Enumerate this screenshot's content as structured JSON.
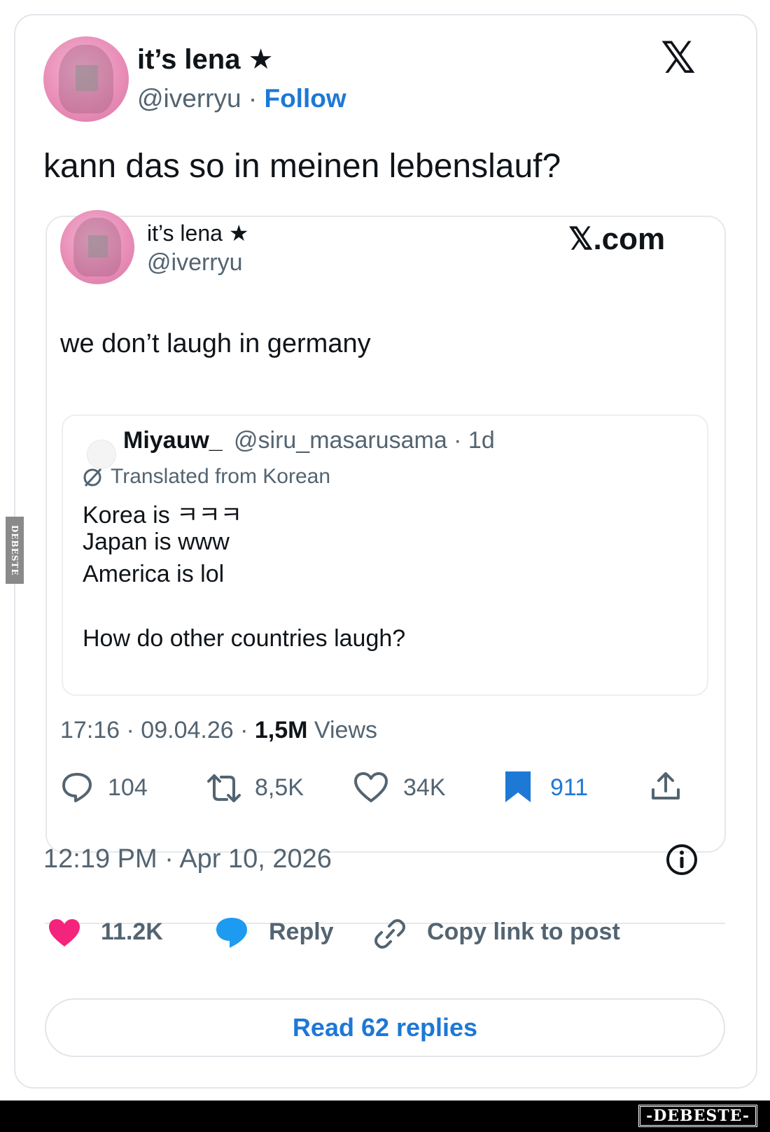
{
  "outer_tweet": {
    "author_name": "it’s lena ★",
    "handle": "@iverryu",
    "separator": "·",
    "follow_label": "Follow",
    "platform_logo": "𝕏",
    "text": "kann das so in meinen lebenslauf?",
    "timestamp": "12:19 PM · Apr 10, 2026",
    "info_icon": "info-icon"
  },
  "embedded_tweet": {
    "author_name": "it’s lena ★",
    "handle": "@iverryu",
    "site_label": "𝕏.com",
    "text": "we don’t laugh in germany",
    "quoted": {
      "author_name": "Miyauw_",
      "handle_time": "@siru_masarusama · 1d",
      "translated_label": "Translated from Korean",
      "lines": [
        "Korea is ㅋㅋㅋ",
        "Japan is www",
        "America is lol",
        "",
        "How do other countries laugh?"
      ]
    },
    "meta": {
      "time_date": "17:16 · 09.04.26 ·",
      "views_count": "1,5M",
      "views_label": "Views"
    },
    "stats": {
      "replies": "104",
      "reposts": "8,5K",
      "likes": "34K",
      "bookmarks": "911"
    }
  },
  "actions": {
    "likes": "11.2K",
    "reply_label": "Reply",
    "copy_link_label": "Copy link to post",
    "read_replies_label": "Read 62 replies"
  },
  "watermark": {
    "bottom": "-DEBESTE-",
    "side": "DEBESTE"
  },
  "colors": {
    "link_blue": "#1d78d6",
    "like_pink": "#f4247c",
    "reply_blue": "#1d9bf0",
    "muted": "#536471"
  }
}
